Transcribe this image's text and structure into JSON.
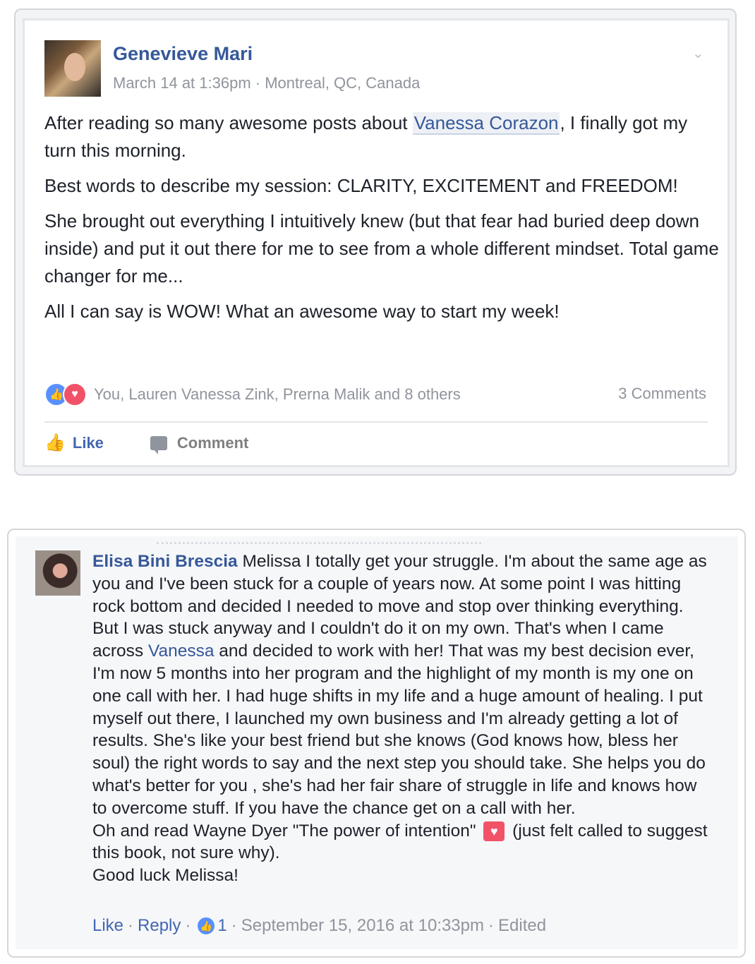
{
  "post": {
    "author": "Genevieve Mari",
    "date": "March 14 at 1:36pm",
    "location": "Montreal, QC, Canada",
    "meta_separator": " · ",
    "p1_before": "After reading so many awesome posts about ",
    "p1_mention": "Vanessa Corazon",
    "p1_after": ", I finally got my turn this morning.",
    "p2": "Best words to describe my session: CLARITY, EXCITEMENT and FREEDOM!",
    "p3": "She brought out everything I intuitively knew (but that fear had buried deep down inside) and put it out there for me to see from a whole different mindset. Total game changer for me...",
    "p4": "All I can say is WOW! What an awesome way to start my week!",
    "reactions_text": "You, Lauren Vanessa Zink, Prerna Malik and 8 others",
    "comments_count": "3 Comments",
    "like_label": "Like",
    "comment_label": "Comment"
  },
  "comment": {
    "author": "Elisa Bini Brescia",
    "text_part1": "Melissa I totally get your struggle. I'm about the same age as you and I've been stuck for a couple of years now. At some point I was hitting rock bottom and decided I needed to move and stop over thinking everything. But I was stuck anyway and I couldn't do it on my own. That's when I came across ",
    "mention": "Vanessa",
    "text_part2": " and decided to work with her! That was my best decision ever, I'm now 5 months into her program and the highlight of my month is my one on one call with her. I had huge shifts in my life and a huge amount of healing. I put myself out there, I launched my own business and I'm already getting a lot of results. She's like your best friend but she knows (God knows how, bless her soul) the right words to say and the next step you should take. She helps you do what's better for you , she's had her fair share of struggle in life and knows how to overcome stuff. If you have the chance get on a call with her.",
    "line_book_before": "Oh and read Wayne Dyer \"The power of intention\"",
    "line_book_after": "(just felt called to suggest this book, not sure why).",
    "closing": "Good luck Melissa!",
    "footer": {
      "like": "Like",
      "reply": "Reply",
      "like_count": "1",
      "timestamp": "September 15, 2016 at 10:33pm",
      "edited": "Edited",
      "dot": "·"
    }
  },
  "colors": {
    "link": "#365899",
    "like_blue": "#5890ff",
    "love_red": "#f25268",
    "meta_gray": "#90949c"
  },
  "icons": [
    "chevron-down-icon",
    "like-reaction-icon",
    "love-reaction-icon",
    "thumbs-up-icon",
    "comment-bubble-icon",
    "heart-emoji-icon"
  ]
}
